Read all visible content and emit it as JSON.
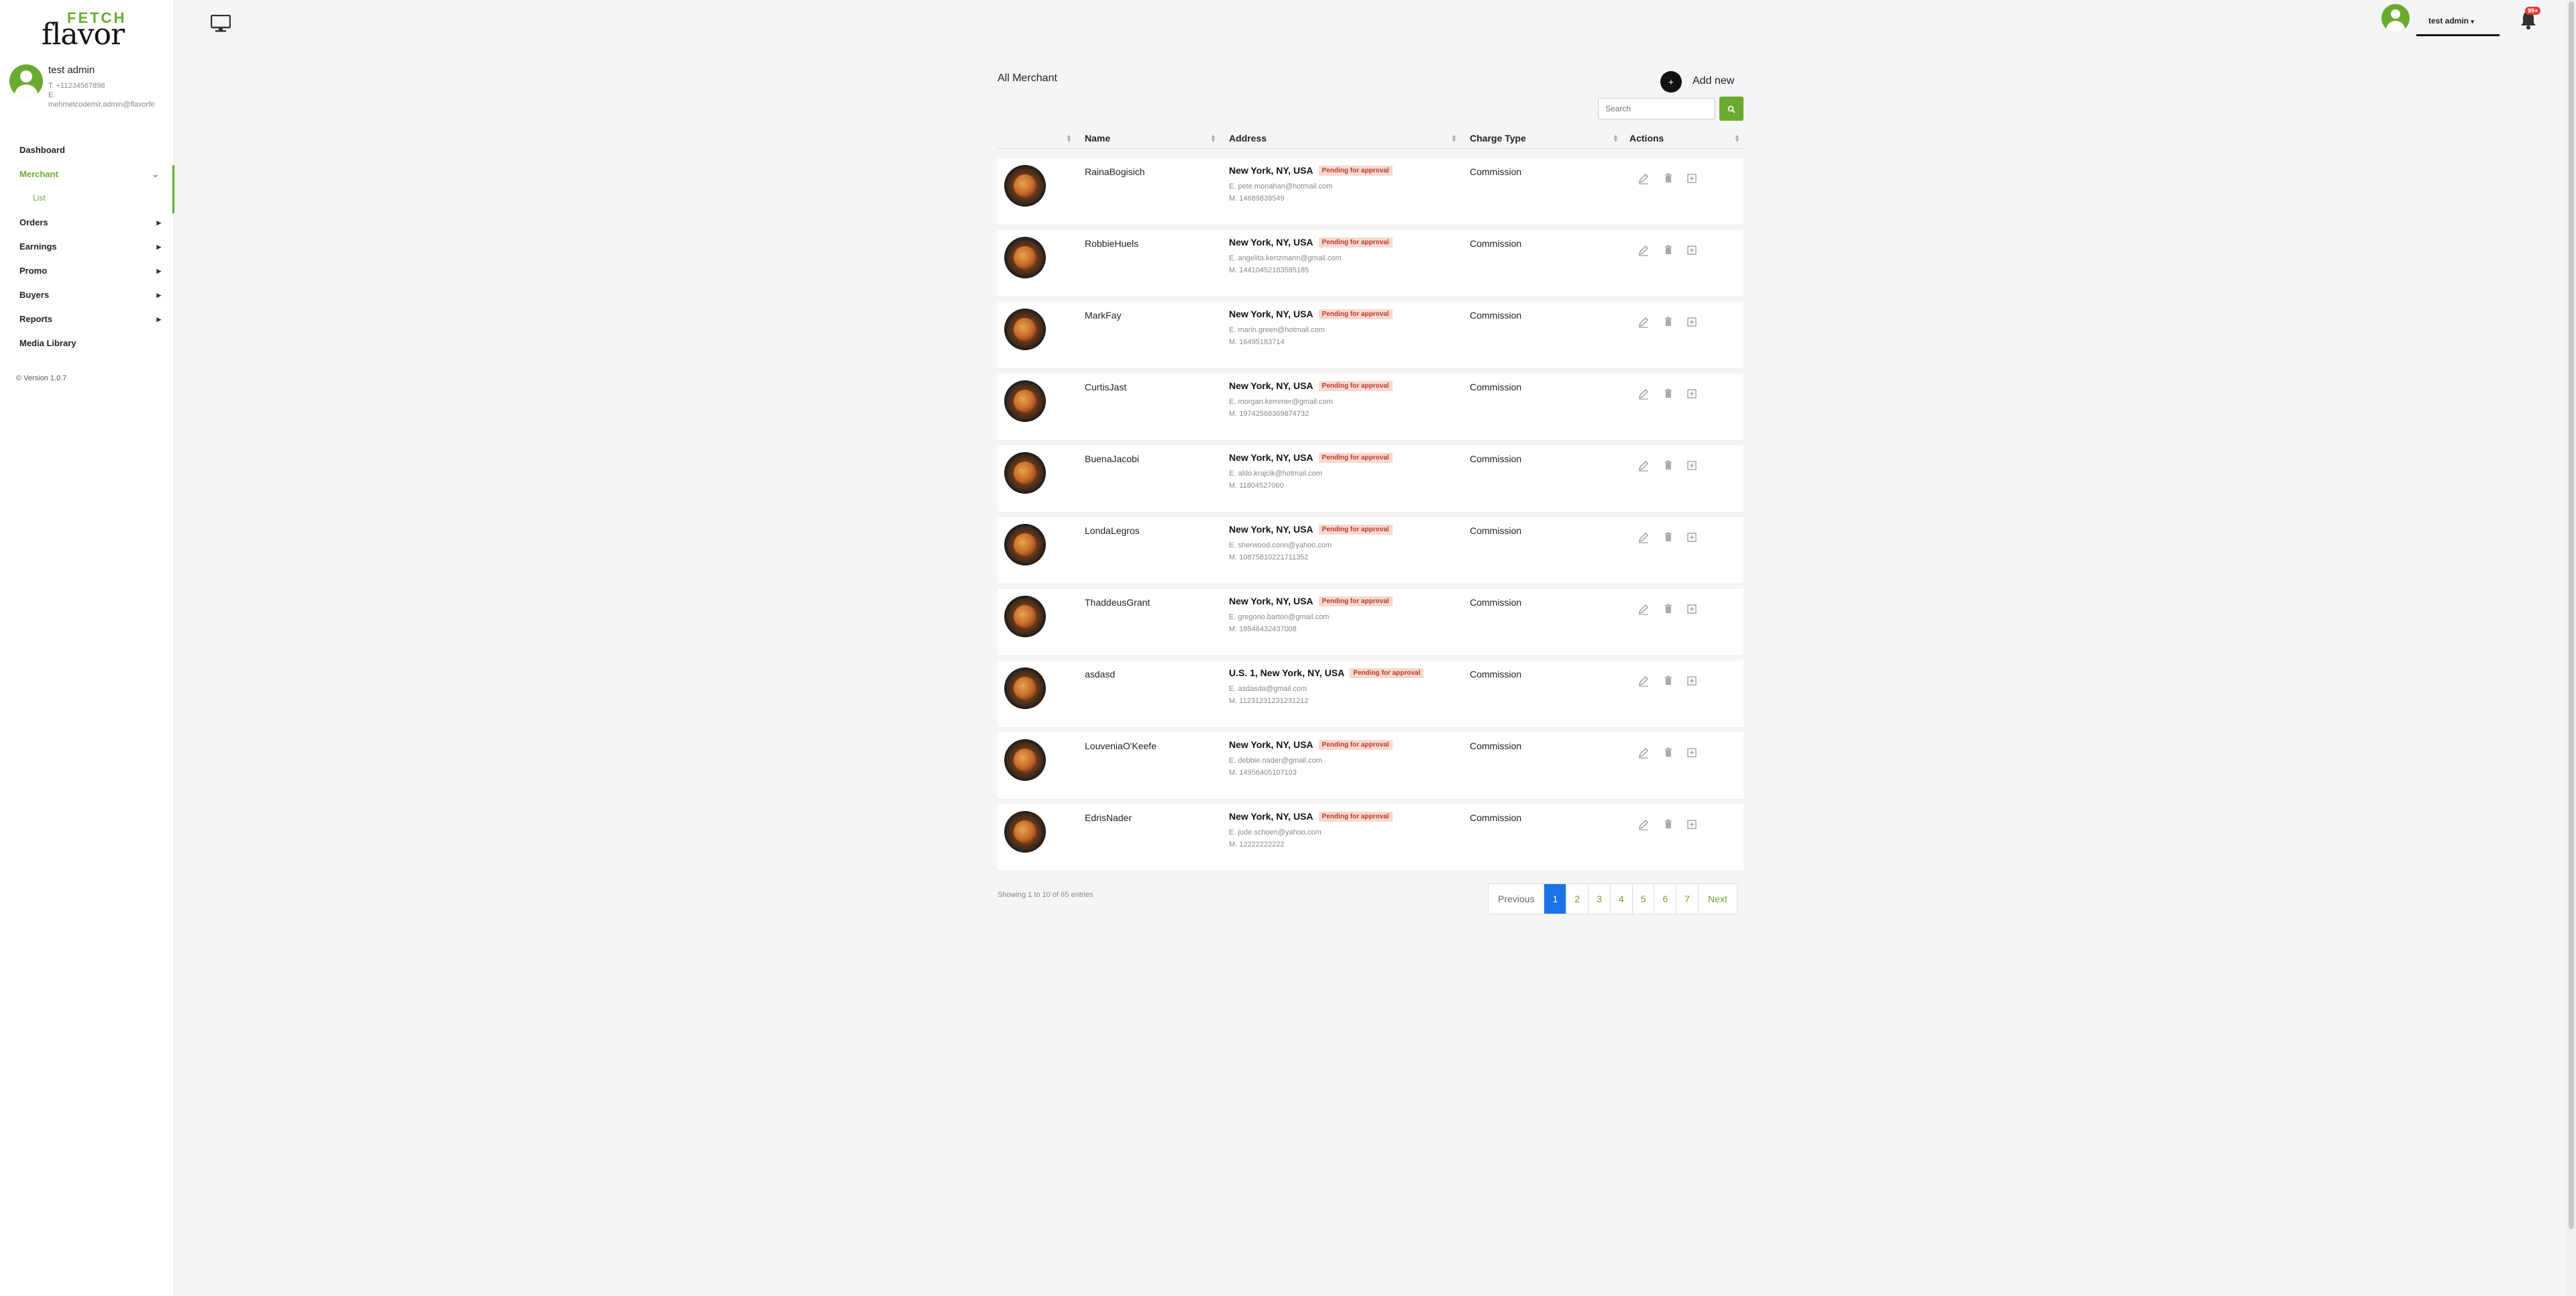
{
  "logo": {
    "top": "FETCH",
    "bottom": "flavor"
  },
  "profile": {
    "name": "test admin",
    "phone": "T. +11234567898",
    "email_prefix": "E.",
    "email": "mehmetcodemir.admin@flavorfe"
  },
  "sidebar": {
    "items": [
      {
        "label": "Dashboard"
      },
      {
        "label": "Merchant"
      },
      {
        "label": "Orders"
      },
      {
        "label": "Earnings"
      },
      {
        "label": "Promo"
      },
      {
        "label": "Buyers"
      },
      {
        "label": "Reports"
      },
      {
        "label": "Media Library"
      }
    ],
    "sub_item": "List",
    "version": "© Version 1.0.7"
  },
  "topbar": {
    "user_name": "test admin",
    "notification_count": "99+"
  },
  "page": {
    "title": "All Merchant",
    "add_new": "Add new",
    "search_placeholder": "Search"
  },
  "table": {
    "headers": [
      "Name",
      "Address",
      "Charge Type",
      "Actions"
    ],
    "rows": [
      {
        "name": "RainaBogisich",
        "address": "New York, NY, USA",
        "status": "Pending for approval",
        "email": "E. pete.monahan@hotmail.com",
        "mobile": "M. 14689839549",
        "charge": "Commission"
      },
      {
        "name": "RobbieHuels",
        "address": "New York, NY, USA",
        "status": "Pending for approval",
        "email": "E. angelita.kertzmann@gmail.com",
        "mobile": "M. 14410452183585185",
        "charge": "Commission"
      },
      {
        "name": "MarkFay",
        "address": "New York, NY, USA",
        "status": "Pending for approval",
        "email": "E. marin.green@hotmail.com",
        "mobile": "M. 16495183714",
        "charge": "Commission"
      },
      {
        "name": "CurtisJast",
        "address": "New York, NY, USA",
        "status": "Pending for approval",
        "email": "E. morgan.kemmer@gmail.com",
        "mobile": "M. 19742568369874732",
        "charge": "Commission"
      },
      {
        "name": "BuenaJacobi",
        "address": "New York, NY, USA",
        "status": "Pending for approval",
        "email": "E. aldo.krajcik@hotmail.com",
        "mobile": "M. 11804527060",
        "charge": "Commission"
      },
      {
        "name": "LondaLegros",
        "address": "New York, NY, USA",
        "status": "Pending for approval",
        "email": "E. sherwood.conn@yahoo.com",
        "mobile": "M. 10875810221711352",
        "charge": "Commission"
      },
      {
        "name": "ThaddeusGrant",
        "address": "New York, NY, USA",
        "status": "Pending for approval",
        "email": "E. gregorio.barton@gmail.com",
        "mobile": "M. 18546432437008",
        "charge": "Commission"
      },
      {
        "name": "asdasd",
        "address": "U.S. 1, New York, NY, USA",
        "status": "Pending for approval",
        "email": "E. asdasda@gmail.com",
        "mobile": "M. 11231231231231212",
        "charge": "Commission"
      },
      {
        "name": "LouveniaO'Keefe",
        "address": "New York, NY, USA",
        "status": "Pending for approval",
        "email": "E. debbie.nader@gmail.com",
        "mobile": "M. 14956405107103",
        "charge": "Commission"
      },
      {
        "name": "EdrisNader",
        "address": "New York, NY, USA",
        "status": "Pending for approval",
        "email": "E. jude.schoen@yahoo.com",
        "mobile": "M. 12222222222",
        "charge": "Commission"
      }
    ]
  },
  "footer": {
    "showing": "Showing 1 to 10 of 65 entries",
    "pages": [
      "Previous",
      "1",
      "2",
      "3",
      "4",
      "5",
      "6",
      "7",
      "Next"
    ]
  },
  "colors": {
    "accent": "#6aab2f",
    "active_page": "#1a73e8",
    "badge_bg": "#f6d9cf",
    "badge_text": "#c0392b"
  }
}
